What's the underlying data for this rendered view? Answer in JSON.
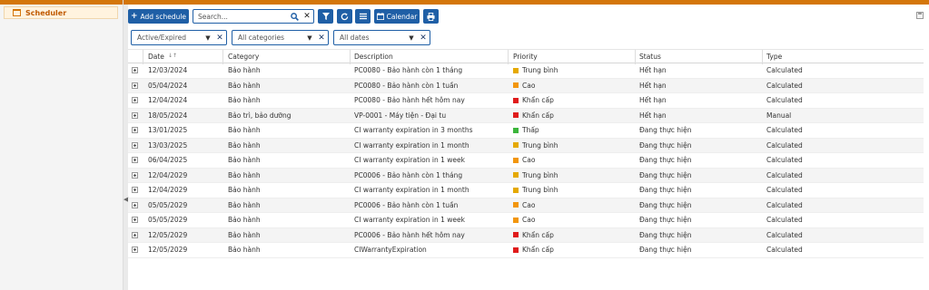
{
  "sidebar": {
    "item_label": "Scheduler"
  },
  "toolbar": {
    "add_label": "Add schedule",
    "search_placeholder": "Search...",
    "calendar_label": "Calendar"
  },
  "filters": {
    "status": "Active/Expired",
    "category": "All categories",
    "dates": "All dates"
  },
  "columns": [
    "Date",
    "Category",
    "Description",
    "Priority",
    "Status",
    "Type"
  ],
  "priority_colors": {
    "Trung bình": "#e5a900",
    "Cao": "#f2960d",
    "Khẩn cấp": "#e01b1b",
    "Thấp": "#3cb53c"
  },
  "rows": [
    {
      "date": "12/03/2024",
      "category": "Bảo hành",
      "description": "PC0080 - Bảo hành còn 1 tháng",
      "priority": "Trung bình",
      "status": "Hết hạn",
      "type": "Calculated"
    },
    {
      "date": "05/04/2024",
      "category": "Bảo hành",
      "description": "PC0080 - Bảo hành còn 1 tuần",
      "priority": "Cao",
      "status": "Hết hạn",
      "type": "Calculated"
    },
    {
      "date": "12/04/2024",
      "category": "Bảo hành",
      "description": "PC0080 - Bảo hành hết hôm nay",
      "priority": "Khẩn cấp",
      "status": "Hết hạn",
      "type": "Calculated"
    },
    {
      "date": "18/05/2024",
      "category": "Bảo trì, bảo dưỡng",
      "description": "VP-0001 - Máy tiện - Đại tu",
      "priority": "Khẩn cấp",
      "status": "Hết hạn",
      "type": "Manual"
    },
    {
      "date": "13/01/2025",
      "category": "Bảo hành",
      "description": "CI warranty expiration in 3 months",
      "priority": "Thấp",
      "status": "Đang thực hiện",
      "type": "Calculated"
    },
    {
      "date": "13/03/2025",
      "category": "Bảo hành",
      "description": "CI warranty expiration in 1 month",
      "priority": "Trung bình",
      "status": "Đang thực hiện",
      "type": "Calculated"
    },
    {
      "date": "06/04/2025",
      "category": "Bảo hành",
      "description": "CI warranty expiration in 1 week",
      "priority": "Cao",
      "status": "Đang thực hiện",
      "type": "Calculated"
    },
    {
      "date": "12/04/2029",
      "category": "Bảo hành",
      "description": "PC0006 - Bảo hành còn 1 tháng",
      "priority": "Trung bình",
      "status": "Đang thực hiện",
      "type": "Calculated"
    },
    {
      "date": "12/04/2029",
      "category": "Bảo hành",
      "description": "CI warranty expiration in 1 month",
      "priority": "Trung bình",
      "status": "Đang thực hiện",
      "type": "Calculated"
    },
    {
      "date": "05/05/2029",
      "category": "Bảo hành",
      "description": "PC0006 - Bảo hành còn 1 tuần",
      "priority": "Cao",
      "status": "Đang thực hiện",
      "type": "Calculated"
    },
    {
      "date": "05/05/2029",
      "category": "Bảo hành",
      "description": "CI warranty expiration in 1 week",
      "priority": "Cao",
      "status": "Đang thực hiện",
      "type": "Calculated"
    },
    {
      "date": "12/05/2029",
      "category": "Bảo hành",
      "description": "PC0006 - Bảo hành hết hôm nay",
      "priority": "Khẩn cấp",
      "status": "Đang thực hiện",
      "type": "Calculated"
    },
    {
      "date": "12/05/2029",
      "category": "Bảo hành",
      "description": "CIWarrantyExpiration",
      "priority": "Khẩn cấp",
      "status": "Đang thực hiện",
      "type": "Calculated"
    }
  ]
}
